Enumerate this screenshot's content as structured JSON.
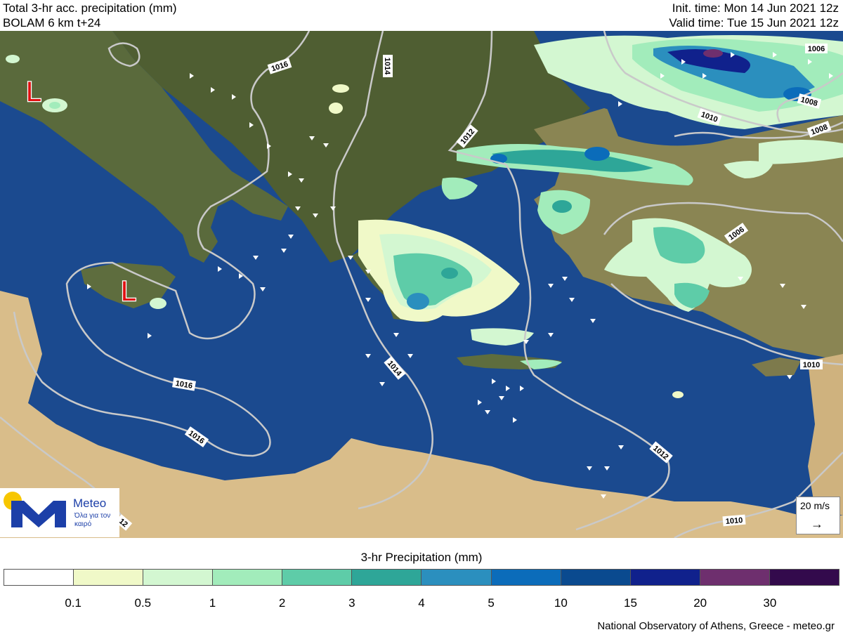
{
  "header": {
    "title_line1": "Total 3-hr acc. precipitation (mm)",
    "title_line2": "BOLAM 6 km t+24",
    "init_time": "Init. time: Mon 14 Jun 2021 12z",
    "valid_time": "Valid time: Tue 15 Jun 2021 12z"
  },
  "map": {
    "low_marker": "L",
    "isobar_labels": [
      "1016",
      "1014",
      "1012",
      "1010",
      "1008",
      "1006",
      "1016",
      "1016",
      "1014",
      "1012",
      "1010",
      "1010",
      "1006",
      "1008",
      "12"
    ],
    "colors": {
      "sea": "#1b4a8f",
      "land": "#5b6b3a",
      "desert": "#d9bd8a",
      "isobar": "#c9c9c9",
      "low": "#e01010"
    }
  },
  "logo": {
    "name": "Meteo",
    "tagline": "Όλα για τον καιρό",
    "colors": {
      "sun": "#f7c600",
      "brand": "#1c3fa8"
    }
  },
  "wind_reference": {
    "label": "20 m/s",
    "arrow": "→"
  },
  "legend": {
    "title": "3-hr Precipitation (mm)",
    "colors": [
      "#ffffff",
      "#f0f9c8",
      "#d3f7d1",
      "#a2ecbb",
      "#5ecca8",
      "#2ea698",
      "#2b8fbe",
      "#0b6cba",
      "#0a4a8f",
      "#10218c",
      "#6e2f6e",
      "#330a4c"
    ],
    "ticks": [
      "0.1",
      "0.5",
      "1",
      "2",
      "3",
      "4",
      "5",
      "10",
      "15",
      "20",
      "30"
    ]
  },
  "credit": "National Observatory of Athens, Greece - meteo.gr"
}
